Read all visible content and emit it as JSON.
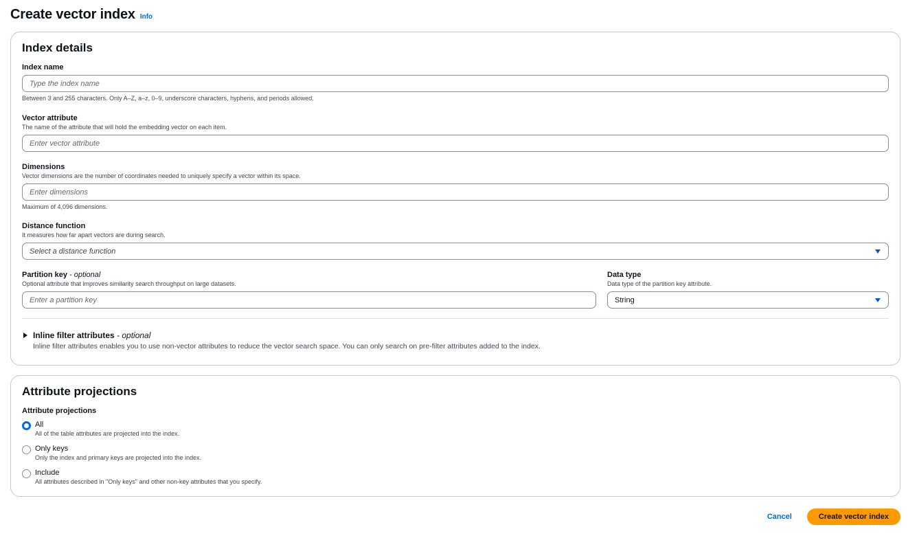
{
  "header": {
    "title": "Create vector index",
    "info": "Info"
  },
  "index_details": {
    "title": "Index details",
    "index_name": {
      "label": "Index name",
      "placeholder": "Type the index name",
      "constraint": "Between 3 and 255 characters. Only A–Z, a–z, 0–9, underscore characters, hyphens, and periods allowed."
    },
    "vector_attribute": {
      "label": "Vector attribute",
      "description": "The name of the attribute that will hold the embedding vector on each item.",
      "placeholder": "Enter vector attribute"
    },
    "dimensions": {
      "label": "Dimensions",
      "description": "Vector dimensions are the number of coordinates needed to uniquely specify a vector within its space.",
      "placeholder": "Enter dimensions",
      "constraint": "Maximum of 4,096 dimensions."
    },
    "distance_function": {
      "label": "Distance function",
      "description": "It measures how far apart vectors are during search.",
      "placeholder": "Select a distance function"
    },
    "partition_key": {
      "label": "Partition key",
      "optional": " - optional",
      "description": "Optional attribute that improves similarity search throughput on large datasets.",
      "placeholder": "Enter a partition key"
    },
    "data_type": {
      "label": "Data type",
      "description": "Data type of the partition key attribute.",
      "value": "String"
    },
    "inline_filter": {
      "title": "Inline filter attributes",
      "optional": " - optional",
      "description": "Inline filter attributes enables you to use non-vector attributes to reduce the vector search space. You can only search on pre-filter attributes added to the index."
    }
  },
  "attribute_projections": {
    "title": "Attribute projections",
    "label": "Attribute projections",
    "options": [
      {
        "label": "All",
        "description": "All of the table attributes are projected into the index.",
        "checked": true
      },
      {
        "label": "Only keys",
        "description": "Only the index and primary keys are projected into the index.",
        "checked": false
      },
      {
        "label": "Include",
        "description": "All attributes described in \"Only keys\" and other non-key attributes that you specify.",
        "checked": false
      }
    ]
  },
  "footer": {
    "cancel": "Cancel",
    "submit": "Create vector index"
  },
  "colors": {
    "accent": "#006ce0",
    "primary_button": "#ff9900"
  }
}
